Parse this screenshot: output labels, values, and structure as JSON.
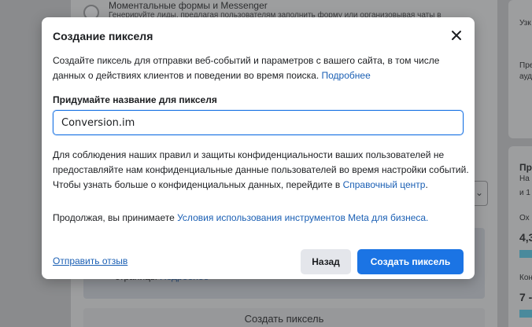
{
  "background": {
    "radio_title": "Моментальные формы и Messenger",
    "radio_desc": "Генерируйте лиды, предлагая пользователям заполнить форму или организовывая чаты в",
    "inner_text_prefix": "страницы",
    "inner_text_link": "Подробнее",
    "bottom_button": "Создать пиксель",
    "right_texts": [
      "Узк",
      "Пре",
      "ауд",
      "Пр",
      "На",
      "и 1",
      "Ох",
      "4,3",
      "Кон",
      "7 -"
    ]
  },
  "modal": {
    "title": "Создание пикселя",
    "intro_text": "Создайте пиксель для отправки веб-событий и параметров с вашего сайта, в том числе данных о действиях клиентов и поведении во время поиска. ",
    "intro_link": "Подробнее",
    "field_label": "Придумайте название для пикселя",
    "input_value": "Conversion.im",
    "policy_text": "Для соблюдения наших правил и защиты конфиденциальности ваших пользователей не предоставляйте нам конфиденциальные данные пользователей во время настройки событий. Чтобы узнать больше о конфиденциальных данных, перейдите в ",
    "policy_link": "Справочный центр",
    "policy_end": ".",
    "terms_prefix": "Продолжая, вы принимаете ",
    "terms_link": "Условия использования инструментов Meta для бизнеса.",
    "feedback_link": "Отправить отзыв",
    "back_button": "Назад",
    "create_button": "Создать пиксель"
  },
  "colors": {
    "primary": "#1b74e4",
    "link": "#1a5fb4",
    "secondary_button": "#e4e6eb"
  }
}
